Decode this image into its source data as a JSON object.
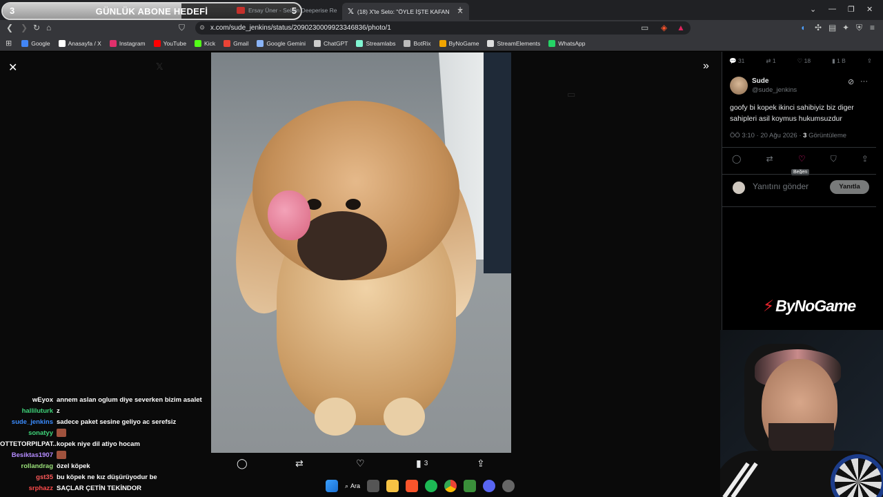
{
  "goal": {
    "current": "3",
    "title": "GÜNLÜK ABONE HEDEFİ",
    "max": "5",
    "progress_fraction": 0.6
  },
  "tabs": [
    {
      "label": "Ersay Üner - Selam Deeperise Re",
      "active": false,
      "favicon_color": "#c4302b"
    },
    {
      "label": "(18) X'te Seto: \"ÖYLE İŞTE KAFAN",
      "active": true,
      "favicon_color": "#ffffff"
    }
  ],
  "address": {
    "url": "x.com/sude_jenkins/status/2090230009923346836/photo/1"
  },
  "bookmarks": [
    {
      "label": "Google",
      "icon": "google-icon",
      "color": "#4285f4"
    },
    {
      "label": "Anasayfa / X",
      "icon": "x-icon",
      "color": "#ffffff"
    },
    {
      "label": "Instagram",
      "icon": "instagram-icon",
      "color": "#e1306c"
    },
    {
      "label": "YouTube",
      "icon": "youtube-icon",
      "color": "#ff0000"
    },
    {
      "label": "Kick",
      "icon": "kick-icon",
      "color": "#53fc18"
    },
    {
      "label": "Gmail",
      "icon": "gmail-icon",
      "color": "#ea4335"
    },
    {
      "label": "Google Gemini",
      "icon": "gemini-icon",
      "color": "#8ab4f8"
    },
    {
      "label": "ChatGPT",
      "icon": "chatgpt-icon",
      "color": "#cccccc"
    },
    {
      "label": "Streamlabs",
      "icon": "streamlabs-icon",
      "color": "#80f5d2"
    },
    {
      "label": "BotRix",
      "icon": "botrix-icon",
      "color": "#bbbbbb"
    },
    {
      "label": "ByNoGame",
      "icon": "bynogame-icon",
      "color": "#f0a500"
    },
    {
      "label": "StreamElements",
      "icon": "streamelements-icon",
      "color": "#dddddd"
    },
    {
      "label": "WhatsApp",
      "icon": "whatsapp-icon",
      "color": "#25d366"
    }
  ],
  "photo_actions": {
    "views": "3"
  },
  "tweet": {
    "top_stats": {
      "replies": "31",
      "reposts": "1",
      "likes": "18",
      "views": "1 B"
    },
    "name": "Sude",
    "handle": "@sude_jenkins",
    "text": "goofy bi kopek ikinci sahibiyiz biz diger sahipleri asil koymus hukumsuzdur",
    "time": "ÖÖ 3:10 · 20 Ağu 2026 ·",
    "views_count": "3",
    "views_label": "Görüntüleme",
    "like_tooltip": "Beğen",
    "reply_placeholder": "Yanıtını gönder",
    "reply_button": "Yanıtla"
  },
  "sponsor": {
    "text": "ByNoGame"
  },
  "chat": [
    {
      "user": "wEyox",
      "color": "#ffffff",
      "msg": "annem aslan oglum diye severken bizim asalet"
    },
    {
      "user": "halliluturk",
      "color": "#3fd47a",
      "msg": "z"
    },
    {
      "user": "sude_jenkins",
      "color": "#3b8cff",
      "msg": "sadece paket sesine geliyo ac serefsiz"
    },
    {
      "user": "sonatyy",
      "color": "#3fd47a",
      "msg": ""
    },
    {
      "user": "OTTETORPILPAT...",
      "color": "#ffffff",
      "msg": "kopek niye dil atiyo hocam"
    },
    {
      "user": "Besiktas1907",
      "color": "#b58cff",
      "msg": ""
    },
    {
      "user": "rollandrag",
      "color": "#9be27a",
      "msg": "özel köpek"
    },
    {
      "user": "gst35",
      "color": "#ff5a5a",
      "msg": "bu köpek ne kız düşürüyodur be"
    },
    {
      "user": "srphazz",
      "color": "#ff4b4b",
      "msg": "SAÇLAR ÇETİN TEKİNDOR"
    }
  ],
  "taskbar": {
    "search_label": "Ara"
  }
}
